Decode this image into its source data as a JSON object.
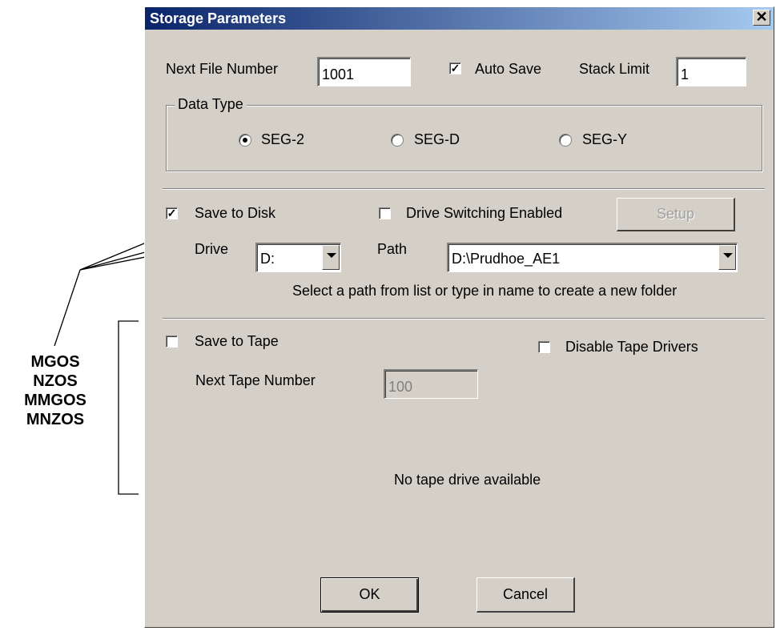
{
  "dialog": {
    "title": "Storage Parameters",
    "close_glyph": "✕",
    "next_file_number_label": "Next File Number",
    "next_file_number_value": "1001",
    "auto_save_label": "Auto Save",
    "auto_save_checked": true,
    "stack_limit_label": "Stack Limit",
    "stack_limit_value": "1",
    "data_type": {
      "legend": "Data Type",
      "options": [
        {
          "label": "SEG-2",
          "selected": true
        },
        {
          "label": "SEG-D",
          "selected": false
        },
        {
          "label": "SEG-Y",
          "selected": false
        }
      ]
    },
    "disk": {
      "save_to_disk_label": "Save to Disk",
      "save_to_disk_checked": true,
      "drive_switching_label": "Drive Switching Enabled",
      "drive_switching_checked": false,
      "setup_label": "Setup",
      "drive_label": "Drive",
      "drive_value": "D:",
      "path_label": "Path",
      "path_value": "D:\\Prudhoe_AE1",
      "hint": "Select a path from list or type in name to create a new folder"
    },
    "tape": {
      "save_to_tape_label": "Save to Tape",
      "save_to_tape_checked": false,
      "disable_drivers_label": "Disable Tape Drivers",
      "disable_drivers_checked": false,
      "next_tape_number_label": "Next Tape Number",
      "next_tape_number_value": "100",
      "status": "No tape drive available"
    },
    "ok_label": "OK",
    "cancel_label": "Cancel"
  },
  "annotation": {
    "lines": [
      "MGOS",
      "NZOS",
      "MMGOS",
      "MNZOS"
    ]
  }
}
